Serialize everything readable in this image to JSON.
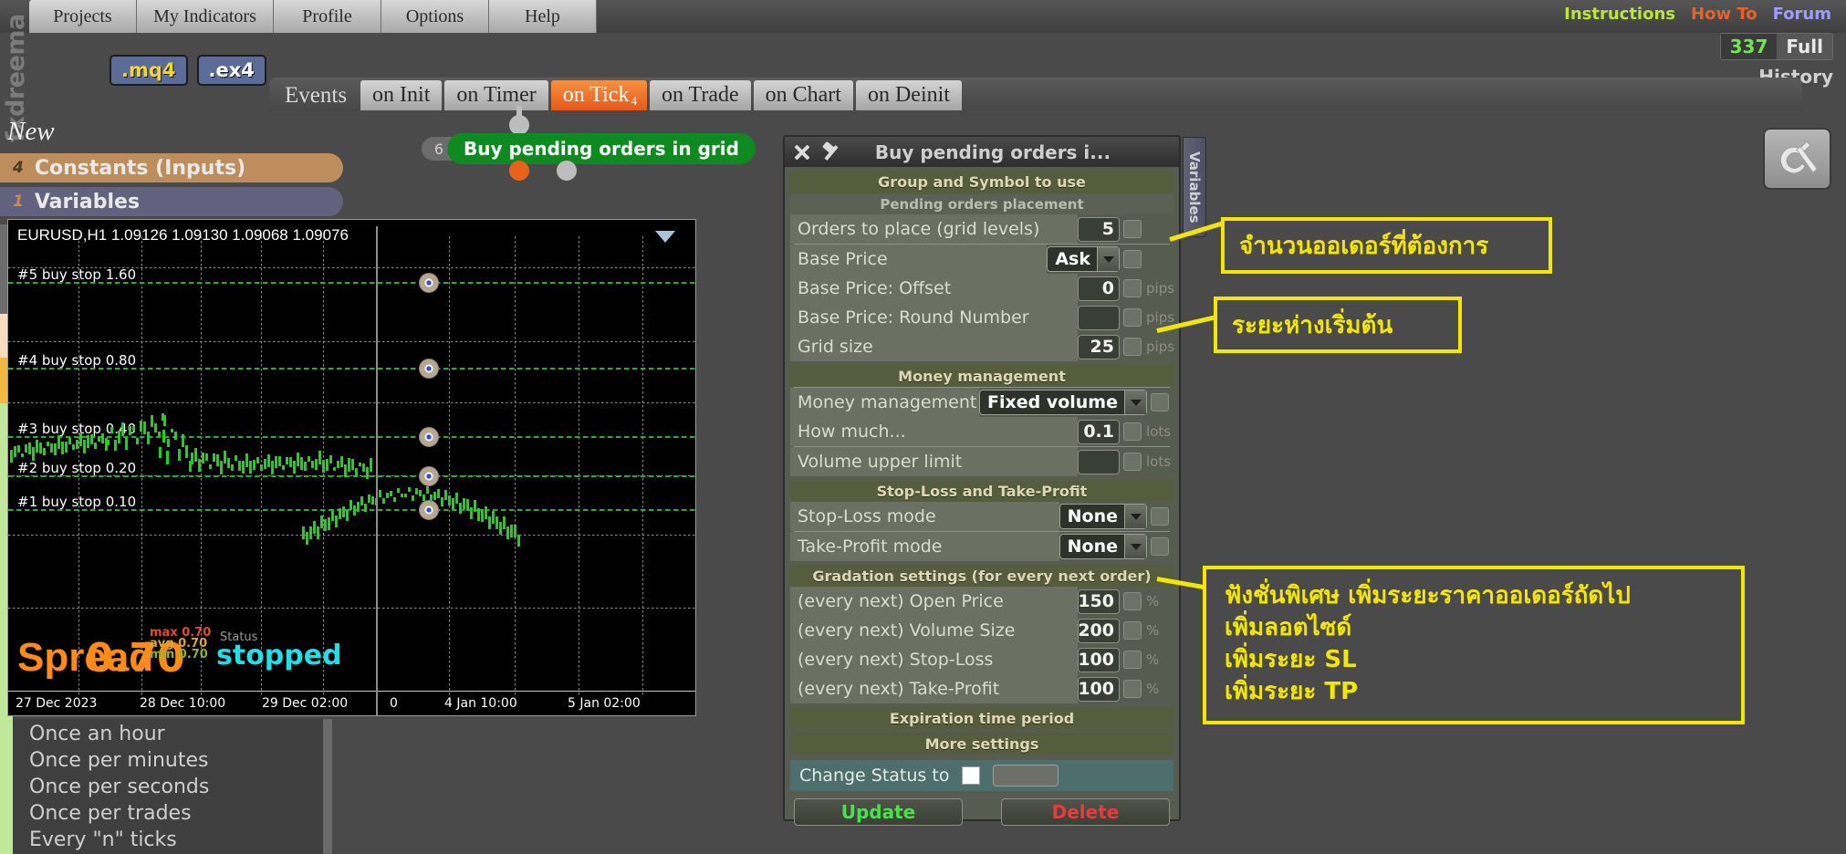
{
  "app": {
    "brand": "fxdreema"
  },
  "menu": {
    "items": [
      {
        "label": "Projects"
      },
      {
        "label": "My Indicators"
      },
      {
        "label": "Profile"
      },
      {
        "label": "Options"
      },
      {
        "label": "Help"
      }
    ]
  },
  "toplinks": {
    "instructions": "Instructions",
    "howto": "How To",
    "forum": "Forum",
    "history_count": "337",
    "history_mode": "Full",
    "history_label": "History"
  },
  "codebuttons": {
    "mq4": ".mq4",
    "ex4": ".ex4"
  },
  "events": {
    "title": "Events",
    "tabs": [
      {
        "label": "on Init",
        "active": false,
        "badge": ""
      },
      {
        "label": "on Timer",
        "active": false,
        "badge": ""
      },
      {
        "label": "on Tick",
        "active": true,
        "badge": "4"
      },
      {
        "label": "on Trade",
        "active": false,
        "badge": ""
      },
      {
        "label": "on Chart",
        "active": false,
        "badge": ""
      },
      {
        "label": "on Deinit",
        "active": false,
        "badge": ""
      }
    ]
  },
  "sidebar": {
    "new_label": "New",
    "items": [
      {
        "num": "4",
        "label": "Constants (Inputs)"
      },
      {
        "num": "1",
        "label": "Variables"
      }
    ]
  },
  "node": {
    "badge": "6",
    "label": "Buy pending orders in grid"
  },
  "chart": {
    "header": "EURUSD,H1  1.09126 1.09130 1.09068 1.09076",
    "symbol": "EURUSD",
    "timeframe": "H1",
    "ohlc": [
      "1.09126",
      "1.09130",
      "1.09068",
      "1.09076"
    ],
    "order_lines": [
      {
        "label": "#5 buy stop 1.60"
      },
      {
        "label": "#4 buy stop 0.80"
      },
      {
        "label": "#3 buy stop 0.40"
      },
      {
        "label": "#2 buy stop 0.20"
      },
      {
        "label": "#1 buy stop 0.10"
      }
    ],
    "spread_label": "Spread",
    "spread_value": "0.70",
    "spread_max": "max 0.70",
    "spread_avg": "avg 0.70",
    "spread_min": "min 0.70",
    "status_label": "Status",
    "status_value": "stopped",
    "time_labels": [
      "27 Dec 2023",
      "28 Dec 10:00",
      "29 Dec 02:00",
      "0",
      "4 Jan 10:00",
      "5 Jan 02:00"
    ]
  },
  "bottom_list": {
    "items": [
      "Once an hour",
      "Once per minutes",
      "Once per seconds",
      "Once per trades",
      "Every \"n\" ticks"
    ]
  },
  "dialog": {
    "title": "Buy pending orders i...",
    "vertical_tab": "Variables",
    "sections": [
      {
        "type": "section",
        "label": "Group and Symbol to use"
      },
      {
        "type": "subsection",
        "label": "Pending orders placement"
      },
      {
        "type": "field",
        "label": "Orders to place (grid levels)",
        "value": "5",
        "control": "number",
        "checkbox": true,
        "unit": ""
      },
      {
        "type": "divider"
      },
      {
        "type": "field",
        "label": "Base Price",
        "value": "Ask",
        "control": "select",
        "checkbox": true,
        "unit": ""
      },
      {
        "type": "field",
        "label": "Base Price: Offset",
        "value": "0",
        "control": "number",
        "checkbox": true,
        "unit": "pips"
      },
      {
        "type": "field",
        "label": "Base Price: Round Number",
        "value": "",
        "control": "number",
        "checkbox": true,
        "unit": "pips"
      },
      {
        "type": "field",
        "label": "Grid size",
        "value": "25",
        "control": "number",
        "checkbox": true,
        "unit": "pips"
      },
      {
        "type": "section",
        "label": "Money management"
      },
      {
        "type": "divider"
      },
      {
        "type": "field",
        "label": "Money management",
        "value": "Fixed volume",
        "control": "select",
        "checkbox": true,
        "unit": ""
      },
      {
        "type": "field",
        "label": "How much...",
        "value": "0.1",
        "control": "number",
        "checkbox": true,
        "unit": "lots"
      },
      {
        "type": "divider"
      },
      {
        "type": "field",
        "label": "Volume upper limit",
        "value": "",
        "control": "number",
        "checkbox": true,
        "unit": "lots"
      },
      {
        "type": "section",
        "label": "Stop-Loss and Take-Profit"
      },
      {
        "type": "field",
        "label": "Stop-Loss mode",
        "value": "None",
        "control": "select",
        "checkbox": true,
        "unit": ""
      },
      {
        "type": "divider"
      },
      {
        "type": "field",
        "label": "Take-Profit mode",
        "value": "None",
        "control": "select",
        "checkbox": true,
        "unit": ""
      },
      {
        "type": "section",
        "label": "Gradation settings (for every next order)"
      },
      {
        "type": "field",
        "label": "(every next) Open Price",
        "value": "150",
        "control": "number",
        "checkbox": true,
        "unit": "%"
      },
      {
        "type": "field",
        "label": "(every next) Volume Size",
        "value": "200",
        "control": "number",
        "checkbox": true,
        "unit": "%"
      },
      {
        "type": "field",
        "label": "(every next) Stop-Loss",
        "value": "100",
        "control": "number",
        "checkbox": true,
        "unit": "%"
      },
      {
        "type": "field",
        "label": "(every next) Take-Profit",
        "value": "100",
        "control": "number",
        "checkbox": true,
        "unit": "%"
      },
      {
        "type": "section",
        "label": "Expiration time period"
      },
      {
        "type": "section",
        "label": "More settings"
      }
    ],
    "status_row": {
      "label": "Change Status to",
      "checked": true,
      "value": ""
    },
    "buttons": {
      "update": "Update",
      "delete": "Delete"
    }
  },
  "annotations": [
    {
      "id": "a1",
      "text": "จำนวนออเดอร์ที่ต้องการ"
    },
    {
      "id": "a2",
      "text": "ระยะห่างเริ่มต้น"
    },
    {
      "id": "a3",
      "lines": [
        "ฟังชั่นพิเศษ เพิ่มระยะราคาออเดอร์ถัดไป",
        "เพิ่มลอตไซด์",
        "เพิ่มระยะ SL",
        "เพิ่มระยะ TP"
      ]
    }
  ],
  "colors": {
    "accent_orange": "#e8591a",
    "annotation_yellow": "#f5e600",
    "node_green": "#0f8a21",
    "constants_brown": "#bd8d5c",
    "variables_purple": "#62627e",
    "update_green": "#4ae24a",
    "delete_red": "#e63c3c",
    "status_cyan": "#23dde8",
    "spread_orange": "#ff8c1a"
  }
}
